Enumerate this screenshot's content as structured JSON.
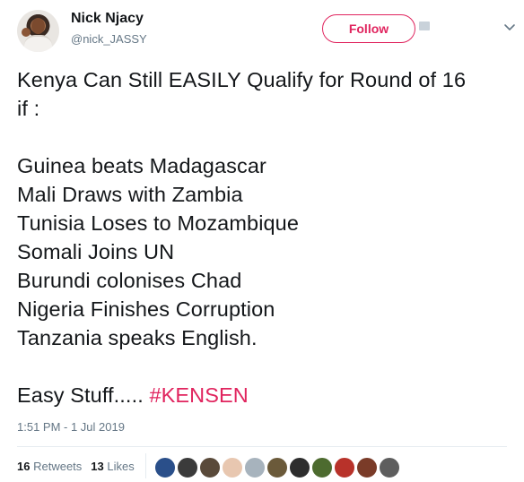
{
  "user": {
    "display_name": "Nick Njacy",
    "handle": "@nick_JASSY",
    "avatar_icon": "profile-photo"
  },
  "actions": {
    "follow_label": "Follow",
    "follow_color": "#e0245e",
    "more_icon": "chevron-down-icon"
  },
  "tweet": {
    "lines": [
      "Kenya Can Still EASILY Qualify for Round of 16",
      "if :",
      "",
      "Guinea beats Madagascar",
      "Mali Draws with Zambia",
      "Tunisia Loses to Mozambique",
      "Somali Joins UN",
      "Burundi colonises Chad",
      "Nigeria Finishes Corruption",
      "Tanzania speaks English.",
      ""
    ],
    "closing_text": "Easy Stuff..... ",
    "hashtag": "#KENSEN",
    "hashtag_color": "#e0245e",
    "timestamp": "1:51 PM - 1 Jul 2019"
  },
  "stats": {
    "retweets_count": "16",
    "retweets_label": "Retweets",
    "likes_count": "13",
    "likes_label": "Likes"
  },
  "likers": [
    {
      "name": "liker-avatar-1",
      "color": "#2a4f8a"
    },
    {
      "name": "liker-avatar-2",
      "color": "#3b3b3b"
    },
    {
      "name": "liker-avatar-3",
      "color": "#5a4a3a"
    },
    {
      "name": "liker-avatar-4",
      "color": "#e8c7b0"
    },
    {
      "name": "liker-avatar-5",
      "color": "#a7b3bd"
    },
    {
      "name": "liker-avatar-6",
      "color": "#6b5a3a"
    },
    {
      "name": "liker-avatar-7",
      "color": "#2d2d2d"
    },
    {
      "name": "liker-avatar-8",
      "color": "#4d6b2f"
    },
    {
      "name": "liker-avatar-9",
      "color": "#b8322a"
    },
    {
      "name": "liker-avatar-10",
      "color": "#7a3b28"
    },
    {
      "name": "liker-avatar-11",
      "color": "#5e5e5e"
    }
  ]
}
